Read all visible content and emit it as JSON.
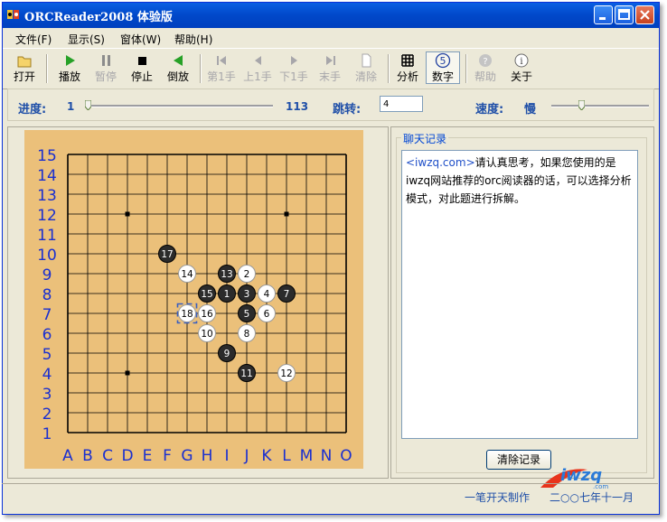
{
  "window": {
    "title": "ORCReader2008 体验版"
  },
  "menu": [
    "文件(F)",
    "显示(S)",
    "窗体(W)",
    "帮助(H)"
  ],
  "toolbar": {
    "open": "打开",
    "play": "播放",
    "pause": "暂停",
    "stop": "停止",
    "reverse": "倒放",
    "first": "第1手",
    "prev": "上1手",
    "next": "下1手",
    "last": "末手",
    "clear": "清除",
    "analyze": "分析",
    "number": "数字",
    "help": "帮助",
    "about": "关于"
  },
  "progress": {
    "label": "进度:",
    "min": "1",
    "max": "113",
    "value_fraction": 0.0
  },
  "jump": {
    "label": "跳转:",
    "value": "4"
  },
  "speed": {
    "label": "速度:",
    "value": "慢",
    "value_fraction": 0.3
  },
  "board": {
    "size": 15,
    "row_labels": [
      "15",
      "14",
      "13",
      "12",
      "11",
      "10",
      "9",
      "8",
      "7",
      "6",
      "5",
      "4",
      "3",
      "2",
      "1"
    ],
    "col_labels": [
      "A",
      "B",
      "C",
      "D",
      "E",
      "F",
      "G",
      "H",
      "I",
      "J",
      "K",
      "L",
      "M",
      "N",
      "O"
    ],
    "star_points": [
      "D12",
      "L12",
      "D4",
      "L4"
    ],
    "stones": [
      {
        "move": "1",
        "color": "black",
        "pos": "I8"
      },
      {
        "move": "2",
        "color": "white",
        "pos": "J9"
      },
      {
        "move": "3",
        "color": "black",
        "pos": "J8"
      },
      {
        "move": "4",
        "color": "white",
        "pos": "K8"
      },
      {
        "move": "5",
        "color": "black",
        "pos": "J7"
      },
      {
        "move": "6",
        "color": "white",
        "pos": "K7"
      },
      {
        "move": "7",
        "color": "black",
        "pos": "L8"
      },
      {
        "move": "8",
        "color": "white",
        "pos": "J6"
      },
      {
        "move": "9",
        "color": "black",
        "pos": "I5"
      },
      {
        "move": "10",
        "color": "white",
        "pos": "H6"
      },
      {
        "move": "11",
        "color": "black",
        "pos": "J4"
      },
      {
        "move": "12",
        "color": "white",
        "pos": "L4"
      },
      {
        "move": "13",
        "color": "black",
        "pos": "I9"
      },
      {
        "move": "14",
        "color": "white",
        "pos": "G9"
      },
      {
        "move": "15",
        "color": "black",
        "pos": "H8"
      },
      {
        "move": "16",
        "color": "white",
        "pos": "H7"
      },
      {
        "move": "17",
        "color": "black",
        "pos": "F10"
      },
      {
        "move": "18",
        "color": "white",
        "pos": "G7"
      }
    ],
    "last_move": "G7"
  },
  "chat": {
    "group_title": "聊天记录",
    "link": "<iwzq.com>",
    "message": "请认真思考，如果您使用的是iwzq网站推荐的orc阅读器的话，可以选择分析模式，对此题进行拆解。",
    "clear_button": "清除记录"
  },
  "status": {
    "author": "一笔开天制作",
    "date": "二○○七年十一月"
  },
  "logo_text": "iwzq.com"
}
